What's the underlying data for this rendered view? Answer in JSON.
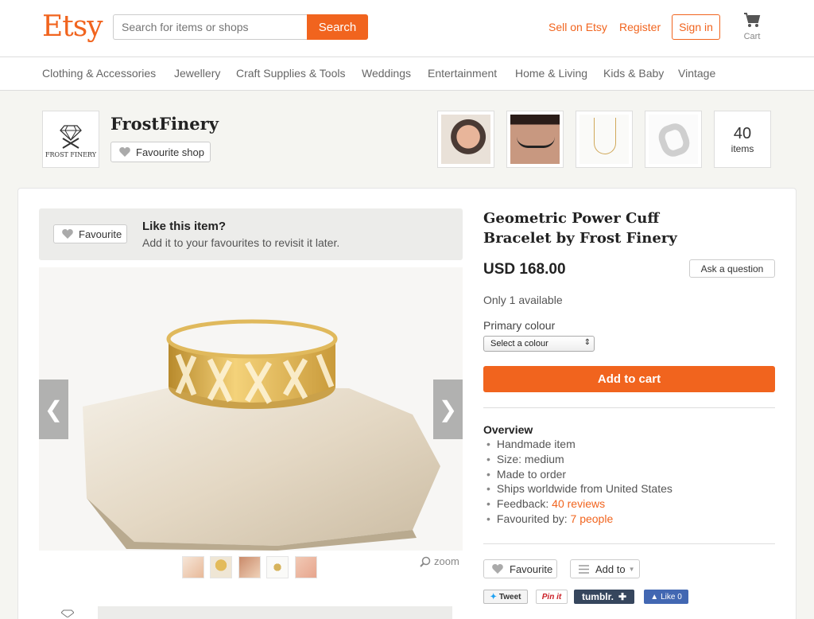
{
  "header": {
    "logo": "Etsy",
    "search_placeholder": "Search for items or shops",
    "search_button": "Search",
    "sell_link": "Sell on Etsy",
    "register_link": "Register",
    "signin_button": "Sign in",
    "cart_label": "Cart"
  },
  "nav": {
    "items": [
      "Clothing & Accessories",
      "Jewellery",
      "Craft Supplies & Tools",
      "Weddings",
      "Entertainment",
      "Home & Living",
      "Kids & Baby",
      "Vintage"
    ]
  },
  "shop": {
    "logo_text": "FROST FINERY",
    "name": "FrostFinery",
    "favourite_button": "Favourite shop",
    "items_count": "40",
    "items_label": "items"
  },
  "like_box": {
    "favourite_button": "Favourite",
    "title": "Like this item?",
    "subtitle": "Add it to your favourites to revisit it later."
  },
  "gallery": {
    "zoom_label": "zoom"
  },
  "product": {
    "title": "Geometric Power Cuff Bracelet by Frost Finery",
    "price": "USD 168.00",
    "ask_button": "Ask a question",
    "availability": "Only 1 available",
    "colour_label": "Primary colour",
    "colour_select": "Select a colour",
    "add_to_cart": "Add to cart"
  },
  "overview": {
    "heading": "Overview",
    "handmade": "Handmade item",
    "size": "Size: medium",
    "made": "Made to order",
    "ships": "Ships worldwide from United States",
    "feedback_label": "Feedback:",
    "feedback_link": "40 reviews",
    "favourited_label": "Favourited by:",
    "favourited_link": "7 people"
  },
  "actions": {
    "favourite": "Favourite",
    "add_to": "Add to",
    "tweet": "Tweet",
    "pinit": "Pin it",
    "tumblr": "tumblr.",
    "like": "Like 0"
  },
  "colors": {
    "accent": "#f1641e"
  }
}
